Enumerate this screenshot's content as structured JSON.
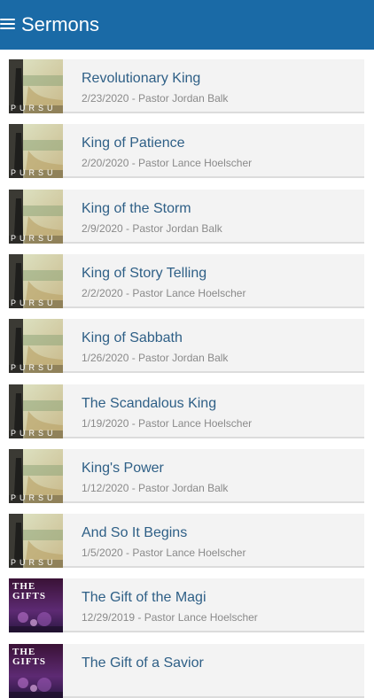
{
  "app": {
    "title": "Sermons",
    "menu_icon": "hamburger-menu-icon"
  },
  "sermons": [
    {
      "title": "Revolutionary King",
      "meta": "2/23/2020 - Pastor Jordan Balk",
      "art": "pursue",
      "art_text": "PURSU"
    },
    {
      "title": "King of Patience",
      "meta": "2/20/2020 - Pastor Lance Hoelscher",
      "art": "pursue",
      "art_text": "PURSU"
    },
    {
      "title": "King of the Storm",
      "meta": "2/9/2020 - Pastor Jordan Balk",
      "art": "pursue",
      "art_text": "PURSU"
    },
    {
      "title": "King of Story Telling",
      "meta": "2/2/2020 - Pastor Lance Hoelscher",
      "art": "pursue",
      "art_text": "PURSU"
    },
    {
      "title": "King of Sabbath",
      "meta": "1/26/2020 - Pastor Jordan Balk",
      "art": "pursue",
      "art_text": "PURSU"
    },
    {
      "title": "The Scandalous King",
      "meta": "1/19/2020 - Pastor Lance Hoelscher",
      "art": "pursue",
      "art_text": "PURSU"
    },
    {
      "title": "King's Power",
      "meta": "1/12/2020 - Pastor Jordan Balk",
      "art": "pursue",
      "art_text": "PURSU"
    },
    {
      "title": "And So It Begins",
      "meta": "1/5/2020 - Pastor Lance Hoelscher",
      "art": "pursue",
      "art_text": "PURSU"
    },
    {
      "title": "The Gift of the Magi",
      "meta": "12/29/2019 - Pastor Lance Hoelscher",
      "art": "gifts",
      "art_text": "THE GIFTS"
    },
    {
      "title": "The Gift of a Savior",
      "meta": "",
      "art": "gifts",
      "art_text": "THE GIFTS"
    }
  ],
  "colors": {
    "appbar": "#1a6aa6",
    "title_text": "#2e5f86",
    "meta_text": "#8a8a8a",
    "card_bg": "#f3f3f3"
  }
}
